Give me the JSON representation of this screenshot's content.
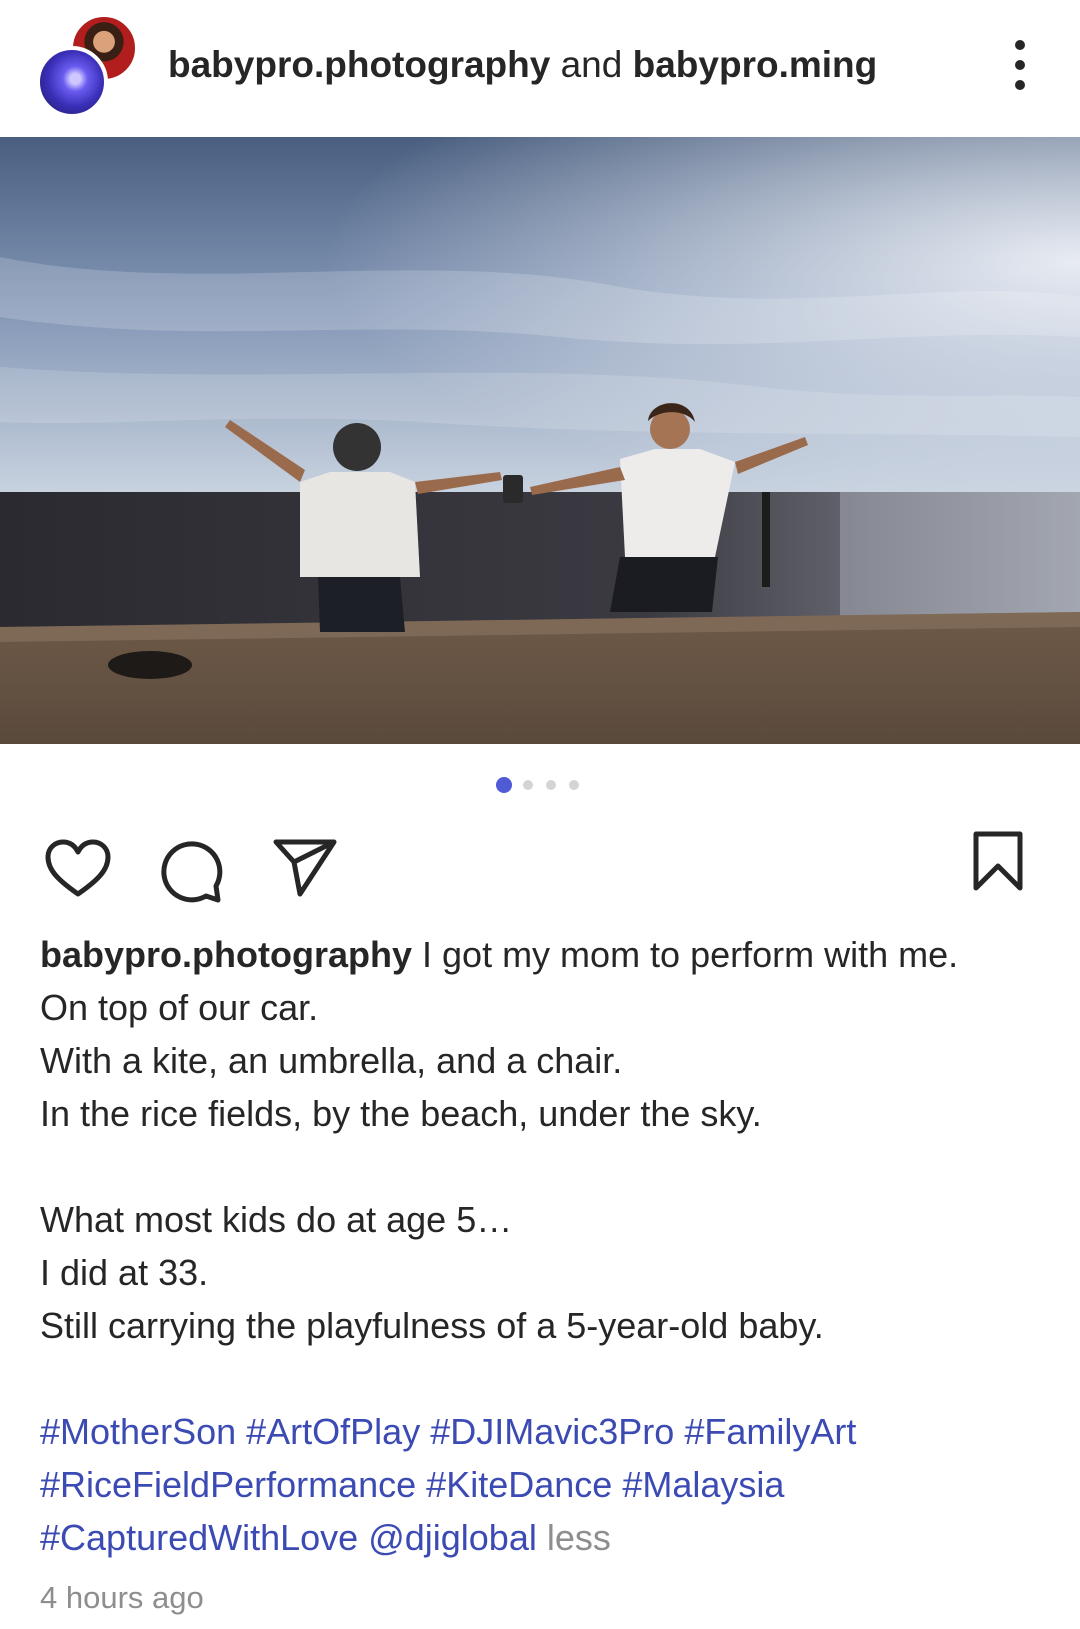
{
  "header": {
    "user1": "babypro.photography",
    "connector": "and",
    "user2": "babypro.ming",
    "more_icon": "more-vertical-icon"
  },
  "carousel": {
    "count": 4,
    "active_index": 1
  },
  "actions": {
    "like_icon": "heart-icon",
    "comment_icon": "comment-icon",
    "share_icon": "paper-plane-icon",
    "save_icon": "bookmark-icon"
  },
  "caption": {
    "username": "babypro.photography",
    "lines": [
      "I got my mom to perform with me.",
      "On top of our car.",
      "With a kite, an umbrella, and a chair.",
      "In the rice fields, by the beach, under the sky.",
      "",
      "What most kids do at age 5…",
      "I did at 33.",
      "Still carrying the playfulness of a 5-year-old baby."
    ],
    "hashtags_line1": [
      "#MotherSon",
      "#ArtOfPlay",
      "#DJIMavic3Pro",
      "#FamilyArt"
    ],
    "hashtags_line2": [
      "#RiceFieldPerformance",
      "#KiteDance",
      "#Malaysia"
    ],
    "hashtags_line3": [
      "#CapturedWithLove"
    ],
    "mention": "@djiglobal",
    "less": "less"
  },
  "timestamp": "4 hours ago",
  "colors": {
    "link": "#3c4bb3",
    "accent_dot": "#4f5bd5",
    "muted": "#8e8e8e",
    "text": "#262626"
  }
}
